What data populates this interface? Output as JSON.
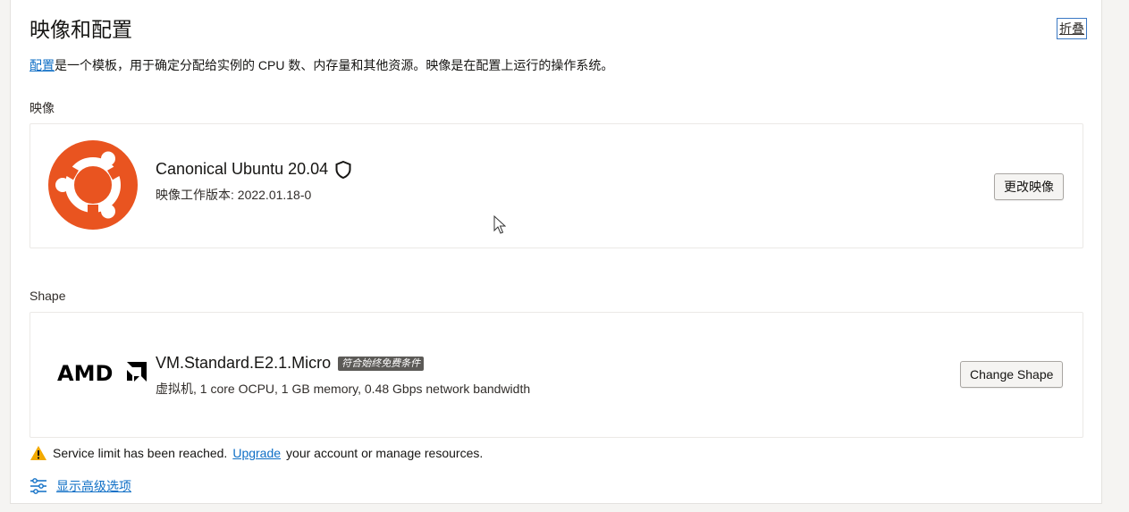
{
  "header": {
    "title": "映像和配置",
    "collapse_label": "折叠"
  },
  "description": {
    "link_text": "配置",
    "text": "是一个模板，用于确定分配给实例的 CPU 数、内存量和其他资源。映像是在配置上运行的操作系统。"
  },
  "image_section": {
    "label": "映像",
    "name": "Canonical Ubuntu 20.04",
    "build_text": "映像工作版本: 2022.01.18-0",
    "change_button": "更改映像"
  },
  "shape_section": {
    "label": "Shape",
    "name": "VM.Standard.E2.1.Micro",
    "badge": "符合始终免费条件",
    "spec": "虚拟机, 1 core OCPU, 1 GB memory, 0.48 Gbps network bandwidth",
    "change_button": "Change Shape",
    "logo_text": "AMD"
  },
  "warning": {
    "before": "Service limit has been reached.",
    "link": "Upgrade",
    "after": "your account or manage resources."
  },
  "advanced": {
    "link": "显示高级选项"
  },
  "colors": {
    "ubuntu_orange": "#e95420",
    "link_blue": "#0f6fc6",
    "warning_yellow": "#f2a900"
  }
}
